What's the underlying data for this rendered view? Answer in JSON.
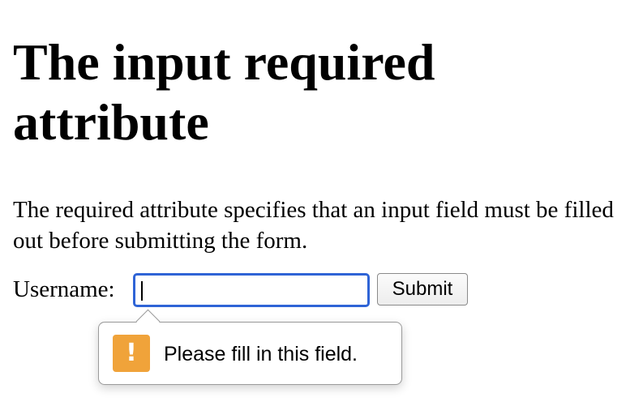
{
  "page": {
    "heading": "The input required attribute",
    "description": "The required attribute specifies that an input field must be filled out before submitting the form."
  },
  "form": {
    "username_label": "Username:",
    "username_value": "",
    "submit_label": "Submit"
  },
  "validation": {
    "message": "Please fill in this field.",
    "icon": "warning-exclamation-icon",
    "icon_color": "#f0a33a"
  },
  "colors": {
    "focus_ring": "#2f64d6"
  }
}
